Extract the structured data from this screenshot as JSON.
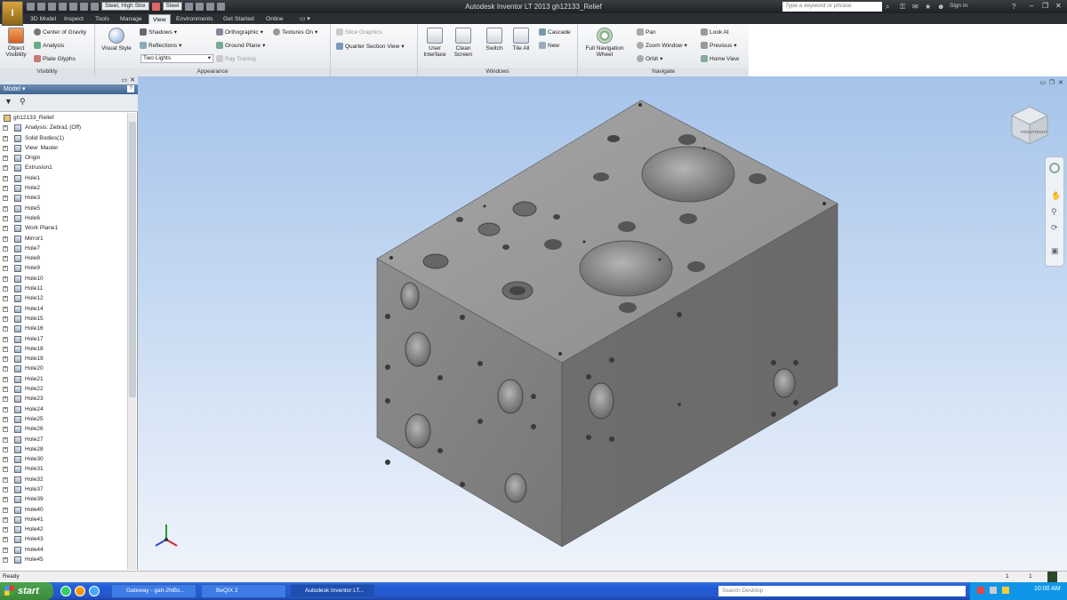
{
  "titlebar": {
    "title": "Autodesk Inventor LT 2013   gh12133_Relief",
    "material": "Steel, High Stre",
    "appearance": "Steel",
    "search_placeholder": "Type a keyword or phrase",
    "sign_in": "Sign In",
    "app_letter": "I"
  },
  "tabs": [
    "3D Model",
    "Inspect",
    "Tools",
    "Manage",
    "View",
    "Environments",
    "Get Started",
    "Online"
  ],
  "ribbon": {
    "visibility": {
      "label": "Visibility",
      "object_visibility": "Object Visibility",
      "center_of_gravity": "Center of Gravity",
      "analysis": "Analysis",
      "plate_glyphs": "Plate Glyphs"
    },
    "appearance": {
      "label": "Appearance",
      "visual_style": "Visual Style",
      "shadows": "Shadows",
      "reflections": "Reflections",
      "lighting": "Two Lights",
      "orthographic": "Orthographic",
      "ground_plane": "Ground Plane",
      "ray_tracing": "Ray Tracing",
      "textures_on": "Textures On",
      "slice_graphics": "Slice Graphics",
      "quarter_section": "Quarter Section View"
    },
    "windows": {
      "label": "Windows",
      "user_interface": "User Interface",
      "clean_screen": "Clean Screen",
      "switch": "Switch",
      "tile_all": "Tile All",
      "cascade": "Cascade",
      "new": "New"
    },
    "navigate": {
      "label": "Navigate",
      "full_nav_wheel": "Full Navigation Wheel",
      "pan": "Pan",
      "zoom_window": "Zoom Window",
      "orbit": "Orbit",
      "look_at": "Look At",
      "previous": "Previous",
      "home_view": "Home View"
    }
  },
  "browser": {
    "title": "Model",
    "items": [
      {
        "label": "gh12133_Relief",
        "level": 0
      },
      {
        "label": "Analysis: Zebra1 (Off)",
        "level": 1
      },
      {
        "label": "Solid Bodies(1)",
        "level": 1
      },
      {
        "label": "View: Master",
        "level": 1
      },
      {
        "label": "Origin",
        "level": 1
      },
      {
        "label": "Extrusion1",
        "level": 1
      },
      {
        "label": "Hole1",
        "level": 1
      },
      {
        "label": "Hole2",
        "level": 1
      },
      {
        "label": "Hole3",
        "level": 1
      },
      {
        "label": "Hole5",
        "level": 1
      },
      {
        "label": "Hole6",
        "level": 1
      },
      {
        "label": "Work Plane1",
        "level": 1
      },
      {
        "label": "Mirror1",
        "level": 1
      },
      {
        "label": "Hole7",
        "level": 1
      },
      {
        "label": "Hole8",
        "level": 1
      },
      {
        "label": "Hole9",
        "level": 1
      },
      {
        "label": "Hole10",
        "level": 1
      },
      {
        "label": "Hole11",
        "level": 1
      },
      {
        "label": "Hole12",
        "level": 1
      },
      {
        "label": "Hole14",
        "level": 1
      },
      {
        "label": "Hole15",
        "level": 1
      },
      {
        "label": "Hole16",
        "level": 1
      },
      {
        "label": "Hole17",
        "level": 1
      },
      {
        "label": "Hole18",
        "level": 1
      },
      {
        "label": "Hole19",
        "level": 1
      },
      {
        "label": "Hole20",
        "level": 1
      },
      {
        "label": "Hole21",
        "level": 1
      },
      {
        "label": "Hole22",
        "level": 1
      },
      {
        "label": "Hole23",
        "level": 1
      },
      {
        "label": "Hole24",
        "level": 1
      },
      {
        "label": "Hole25",
        "level": 1
      },
      {
        "label": "Hole26",
        "level": 1
      },
      {
        "label": "Hole27",
        "level": 1
      },
      {
        "label": "Hole28",
        "level": 1
      },
      {
        "label": "Hole30",
        "level": 1
      },
      {
        "label": "Hole31",
        "level": 1
      },
      {
        "label": "Hole32",
        "level": 1
      },
      {
        "label": "Hole37",
        "level": 1
      },
      {
        "label": "Hole39",
        "level": 1
      },
      {
        "label": "Hole40",
        "level": 1
      },
      {
        "label": "Hole41",
        "level": 1
      },
      {
        "label": "Hole42",
        "level": 1
      },
      {
        "label": "Hole43",
        "level": 1
      },
      {
        "label": "Hole44",
        "level": 1
      },
      {
        "label": "Hole45",
        "level": 1
      }
    ]
  },
  "viewcube": {
    "front": "FRONT",
    "right": "RIGHT"
  },
  "status": {
    "text": "Ready",
    "count1": "1",
    "count2": "1"
  },
  "taskbar": {
    "start": "start",
    "buttons": [
      "Gateway - gah-2NBs...",
      "BeQIX 2",
      "Autodesk Inventor LT..."
    ],
    "search_placeholder": "Search Desktop",
    "clock": "10:00 AM"
  }
}
